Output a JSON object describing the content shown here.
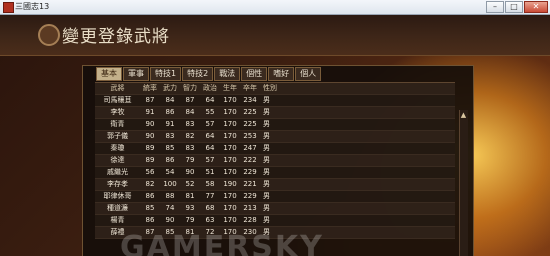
{
  "window": {
    "title": "三國志13",
    "min": "–",
    "max": "□",
    "close": "✕"
  },
  "page": {
    "title": "變更登錄武將",
    "crest_icon": "crest-icon"
  },
  "tabs": [
    "基本",
    "軍事",
    "特技1",
    "特技2",
    "戰法",
    "個性",
    "嗜好",
    "個人"
  ],
  "active_tab": 0,
  "table": {
    "columns": [
      "武將",
      "統率",
      "武力",
      "智力",
      "政治",
      "生年",
      "卒年",
      "性別"
    ],
    "rows": [
      [
        "司馬穰苴",
        "87",
        "84",
        "87",
        "64",
        "170",
        "234",
        "男"
      ],
      [
        "李牧",
        "91",
        "86",
        "84",
        "55",
        "170",
        "225",
        "男"
      ],
      [
        "衛青",
        "90",
        "91",
        "83",
        "57",
        "170",
        "225",
        "男"
      ],
      [
        "郭子儀",
        "90",
        "83",
        "82",
        "64",
        "170",
        "253",
        "男"
      ],
      [
        "秦瓊",
        "89",
        "85",
        "83",
        "64",
        "170",
        "247",
        "男"
      ],
      [
        "徐達",
        "89",
        "86",
        "79",
        "57",
        "170",
        "222",
        "男"
      ],
      [
        "戚繼光",
        "56",
        "54",
        "90",
        "51",
        "170",
        "229",
        "男"
      ],
      [
        "李存孝",
        "82",
        "100",
        "52",
        "58",
        "190",
        "221",
        "男"
      ],
      [
        "耶律休哥",
        "86",
        "88",
        "81",
        "77",
        "170",
        "229",
        "男"
      ],
      [
        "種道濂",
        "85",
        "74",
        "93",
        "68",
        "170",
        "213",
        "男"
      ],
      [
        "楊青",
        "86",
        "90",
        "79",
        "63",
        "170",
        "228",
        "男"
      ],
      [
        "薛禮",
        "87",
        "85",
        "81",
        "72",
        "170",
        "230",
        "男"
      ]
    ]
  },
  "scroll_up_icon": "▲",
  "watermark": "GAMERSKY"
}
